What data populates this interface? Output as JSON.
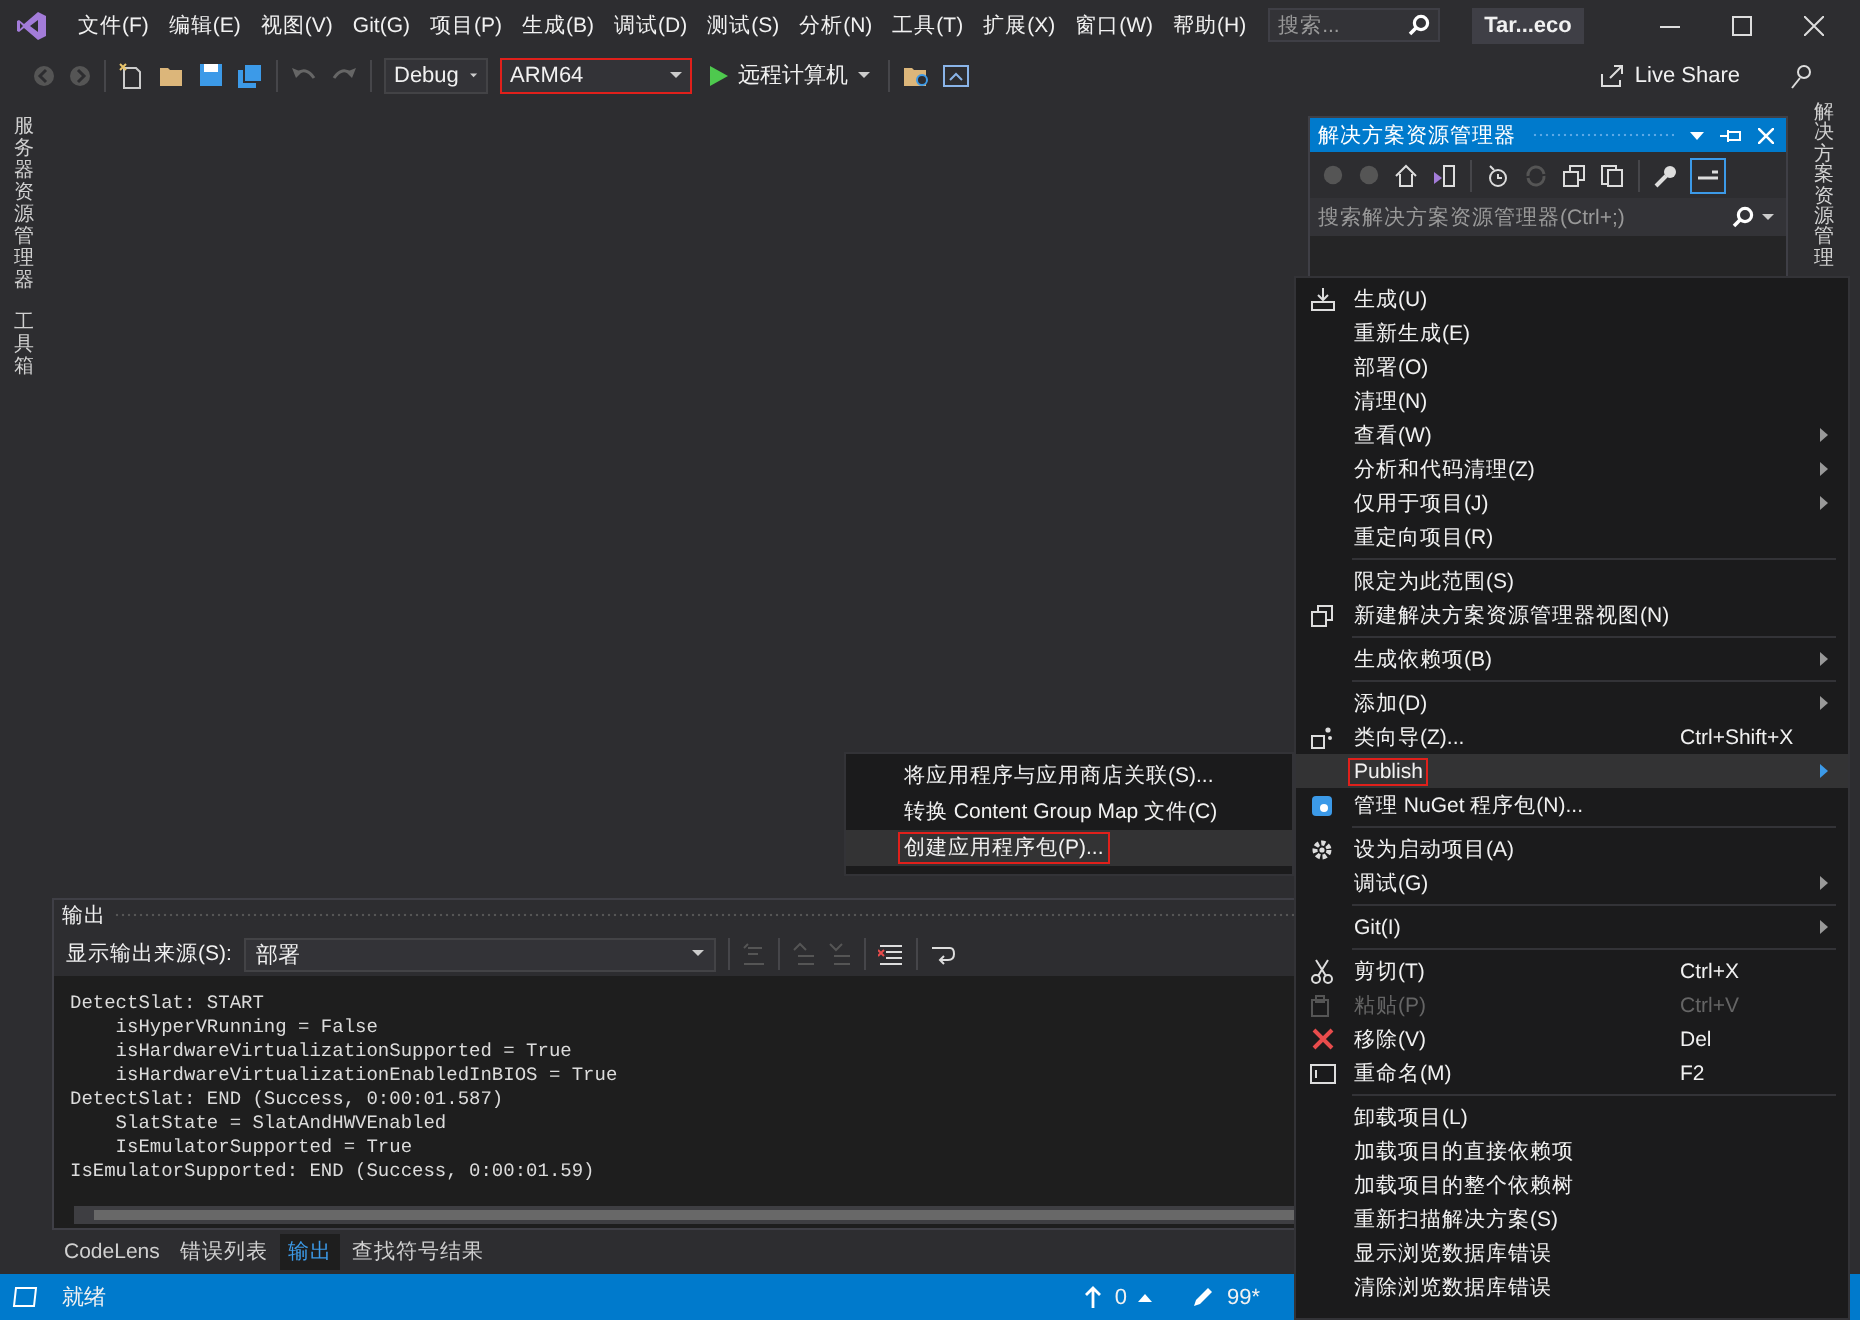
{
  "title_bar": {
    "menus": [
      "文件(F)",
      "编辑(E)",
      "视图(V)",
      "Git(G)",
      "项目(P)",
      "生成(B)",
      "调试(D)",
      "测试(S)",
      "分析(N)",
      "工具(T)",
      "扩展(X)",
      "窗口(W)",
      "帮助(H)"
    ],
    "search": {
      "placeholder": "搜索..."
    },
    "title": "Tar...eco"
  },
  "toolbar": {
    "configuration": "Debug",
    "platform": {
      "value": "ARM64",
      "annotated": true
    },
    "run_target": "远程计算机",
    "live_share": "Live Share"
  },
  "left_tabs": [
    "服务器资源管理器",
    "工具箱"
  ],
  "right_tabs": [
    "解决方案资源管理"
  ],
  "solution_explorer": {
    "title": "解决方案资源管理器",
    "search": {
      "placeholder": "搜索解决方案资源管理器(Ctrl+;)"
    }
  },
  "context_menu": {
    "groups": [
      [
        {
          "label": "生成(U)",
          "submenu": false,
          "disabled": false,
          "selected": false,
          "annotated": false
        },
        {
          "label": "重新生成(E)",
          "submenu": false,
          "disabled": false,
          "selected": false,
          "annotated": false
        },
        {
          "label": "部署(O)",
          "submenu": false,
          "disabled": false,
          "selected": false,
          "annotated": false
        },
        {
          "label": "清理(N)",
          "submenu": false,
          "disabled": false,
          "selected": false,
          "annotated": false
        },
        {
          "label": "查看(W)",
          "submenu": true,
          "disabled": false,
          "selected": false,
          "annotated": false
        },
        {
          "label": "分析和代码清理(Z)",
          "submenu": true,
          "disabled": false,
          "selected": false,
          "annotated": false
        },
        {
          "label": "仅用于项目(J)",
          "submenu": true,
          "disabled": false,
          "selected": false,
          "annotated": false
        },
        {
          "label": "重定向项目(R)",
          "submenu": false,
          "disabled": false,
          "selected": false,
          "annotated": false
        }
      ],
      [
        {
          "label": "限定为此范围(S)",
          "submenu": false,
          "disabled": false,
          "selected": false,
          "annotated": false
        },
        {
          "label": "新建解决方案资源管理器视图(N)",
          "submenu": false,
          "disabled": false,
          "selected": false,
          "annotated": false
        }
      ],
      [
        {
          "label": "生成依赖项(B)",
          "submenu": true,
          "disabled": false,
          "selected": false,
          "annotated": false
        }
      ],
      [
        {
          "label": "添加(D)",
          "submenu": true,
          "disabled": false,
          "selected": false,
          "annotated": false
        },
        {
          "label": "类向导(Z)...",
          "shortcut": "Ctrl+Shift+X",
          "submenu": false,
          "disabled": false,
          "selected": false,
          "annotated": false
        },
        {
          "label": "Publish",
          "submenu": true,
          "disabled": false,
          "selected": true,
          "annotated": true
        },
        {
          "label": "管理 NuGet 程序包(N)...",
          "submenu": false,
          "disabled": false,
          "selected": false,
          "annotated": false
        }
      ],
      [
        {
          "label": "设为启动项目(A)",
          "submenu": false,
          "disabled": false,
          "selected": false,
          "annotated": false
        },
        {
          "label": "调试(G)",
          "submenu": true,
          "disabled": false,
          "selected": false,
          "annotated": false
        }
      ],
      [
        {
          "label": "Git(I)",
          "submenu": true,
          "disabled": false,
          "selected": false,
          "annotated": false
        }
      ],
      [
        {
          "label": "剪切(T)",
          "shortcut": "Ctrl+X",
          "submenu": false,
          "disabled": false,
          "selected": false,
          "annotated": false
        },
        {
          "label": "粘贴(P)",
          "shortcut": "Ctrl+V",
          "submenu": false,
          "disabled": true,
          "selected": false,
          "annotated": false
        },
        {
          "label": "移除(V)",
          "shortcut": "Del",
          "submenu": false,
          "disabled": false,
          "selected": false,
          "annotated": false
        },
        {
          "label": "重命名(M)",
          "shortcut": "F2",
          "submenu": false,
          "disabled": false,
          "selected": false,
          "annotated": false
        }
      ],
      [
        {
          "label": "卸载项目(L)",
          "submenu": false,
          "disabled": false,
          "selected": false,
          "annotated": false
        },
        {
          "label": "加载项目的直接依赖项",
          "submenu": false,
          "disabled": false,
          "selected": false,
          "annotated": false
        },
        {
          "label": "加载项目的整个依赖树",
          "submenu": false,
          "disabled": false,
          "selected": false,
          "annotated": false
        },
        {
          "label": "重新扫描解决方案(S)",
          "submenu": false,
          "disabled": false,
          "selected": false,
          "annotated": false
        },
        {
          "label": "显示浏览数据库错误",
          "submenu": false,
          "disabled": false,
          "selected": false,
          "annotated": false
        },
        {
          "label": "清除浏览数据库错误",
          "submenu": false,
          "disabled": false,
          "selected": false,
          "annotated": false
        }
      ]
    ]
  },
  "submenu": {
    "items": [
      {
        "label": "将应用程序与应用商店关联(S)...",
        "selected": false,
        "annotated": false
      },
      {
        "label": "转换 Content Group Map 文件(C)",
        "selected": false,
        "annotated": false
      },
      {
        "label": "创建应用程序包(P)...",
        "selected": true,
        "annotated": true
      }
    ]
  },
  "output": {
    "title": "输出",
    "source_label": "显示输出来源(S):",
    "source": "部署",
    "lines": [
      "DetectSlat: START",
      "    isHyperVRunning = False",
      "    isHardwareVirtualizationSupported = True",
      "    isHardwareVirtualizationEnabledInBIOS = True",
      "DetectSlat: END (Success, 0:00:01.587)",
      "    SlatState = SlatAndHWVEnabled",
      "    IsEmulatorSupported = True",
      "IsEmulatorSupported: END (Success, 0:00:01.59)"
    ]
  },
  "bottom_tabs": [
    {
      "label": "CodeLens",
      "selected": false
    },
    {
      "label": "错误列表",
      "selected": false
    },
    {
      "label": "输出",
      "selected": true
    },
    {
      "label": "查找符号结果",
      "selected": false
    }
  ],
  "status_bar": {
    "text": "就绪",
    "up_count": "0",
    "edits": "99*"
  }
}
